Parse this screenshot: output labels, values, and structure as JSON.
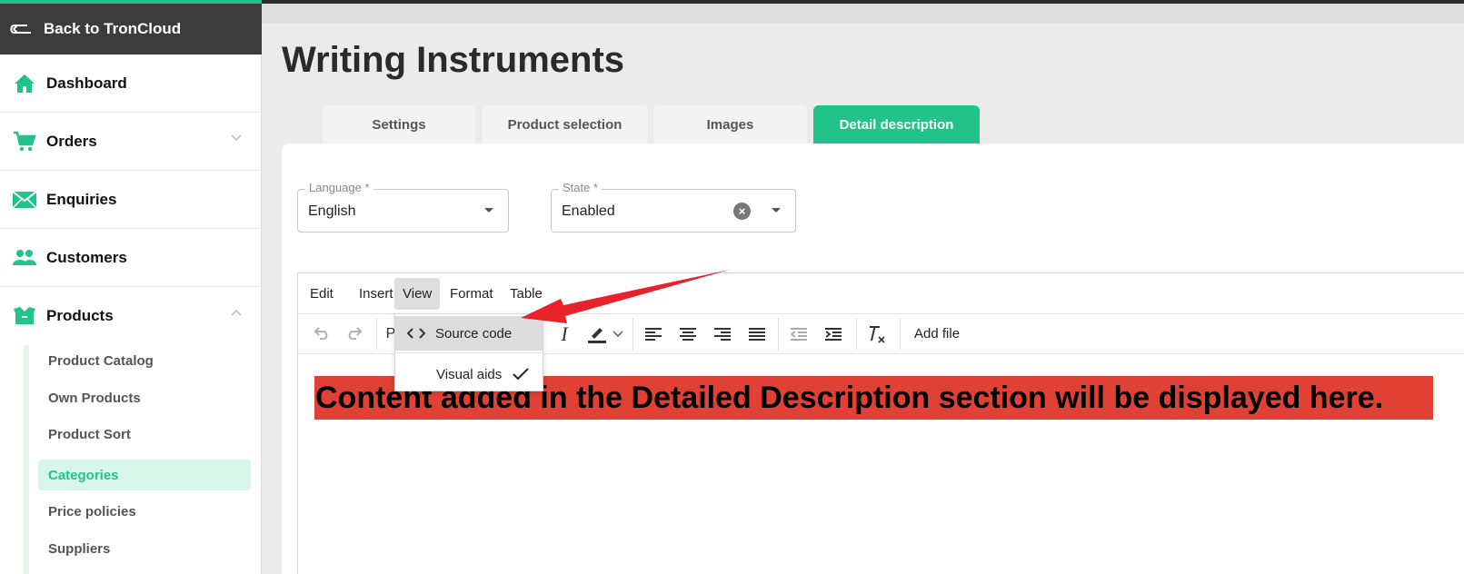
{
  "sidebar": {
    "back_label": "Back to TronCloud",
    "nav": [
      {
        "label": "Dashboard",
        "icon": "home-icon"
      },
      {
        "label": "Orders",
        "icon": "cart-icon"
      },
      {
        "label": "Enquiries",
        "icon": "envelope-icon"
      },
      {
        "label": "Customers",
        "icon": "users-icon"
      },
      {
        "label": "Products",
        "icon": "box-icon"
      }
    ],
    "products_sub": [
      {
        "label": "Product Catalog"
      },
      {
        "label": "Own Products"
      },
      {
        "label": "Product Sort"
      },
      {
        "label": "Categories",
        "active": true
      },
      {
        "label": "Price policies"
      },
      {
        "label": "Suppliers"
      }
    ]
  },
  "page": {
    "title": "Writing Instruments"
  },
  "tabs": [
    {
      "label": "Settings"
    },
    {
      "label": "Product selection"
    },
    {
      "label": "Images"
    },
    {
      "label": "Detail description",
      "active": true
    }
  ],
  "form": {
    "language": {
      "legend": "Language *",
      "value": "English"
    },
    "state": {
      "legend": "State *",
      "value": "Enabled"
    }
  },
  "editor": {
    "menus": [
      "Edit",
      "Insert",
      "View",
      "Format",
      "Table"
    ],
    "open_menu": "View",
    "view_menu": [
      {
        "label": "Source code",
        "icon": "code-icon",
        "highlighted": true
      },
      {
        "label": "Visual aids",
        "icon": "check-icon",
        "checked": true
      }
    ],
    "toolbar": {
      "partial_text": "P",
      "add_file": "Add file"
    },
    "content": "Content added in the Detailed Description section will be displayed here."
  },
  "colors": {
    "accent": "#22c38a",
    "sidebar_back": "#3c3c3c",
    "highlight": "#e14134",
    "annotation_arrow": "#e8222a"
  }
}
